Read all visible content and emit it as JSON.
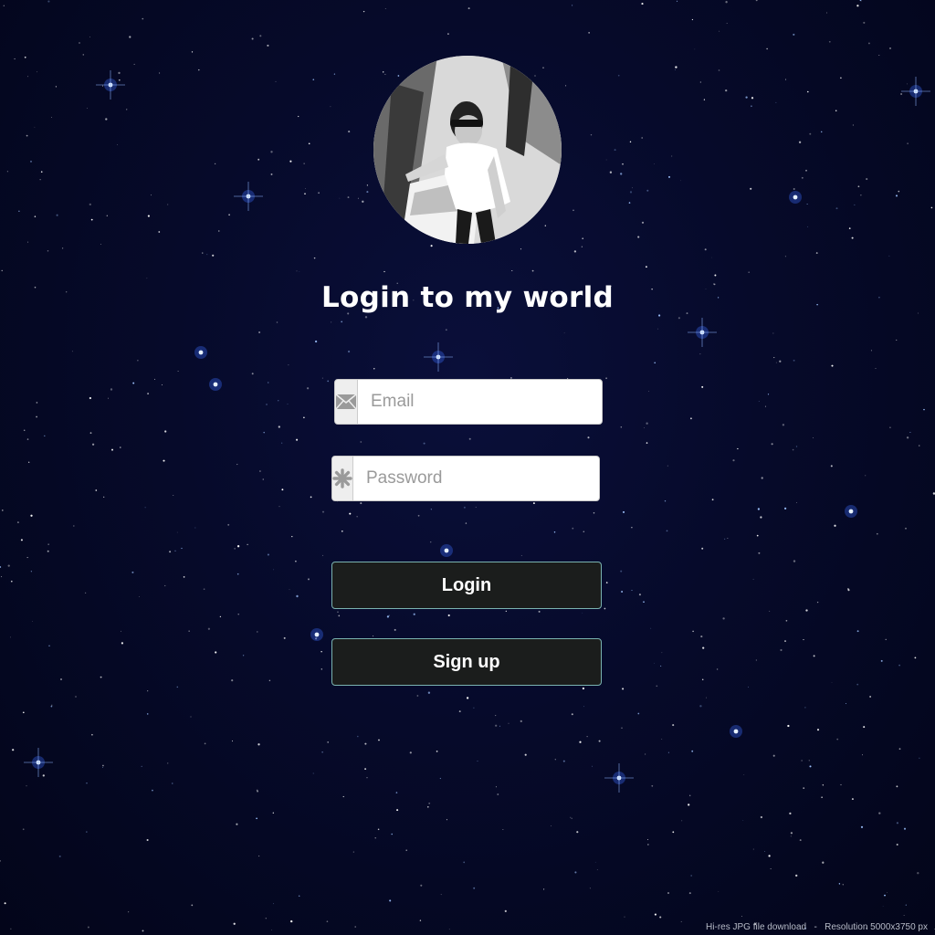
{
  "page": {
    "background_color": "#060a2a",
    "accent_border": "#7ab3b0"
  },
  "profile": {
    "avatar_desc_icon": "user-photo"
  },
  "heading": {
    "title": "Login to my world"
  },
  "form": {
    "email": {
      "icon": "envelope-icon",
      "placeholder": "Email",
      "value": ""
    },
    "password": {
      "icon": "asterisk-icon",
      "placeholder": "Password",
      "value": ""
    },
    "login_label": "Login",
    "signup_label": "Sign up"
  },
  "footer": {
    "download_text": "Hi-res JPG file download",
    "separator": "-",
    "resolution_text": "Resolution 5000x3750 px"
  }
}
